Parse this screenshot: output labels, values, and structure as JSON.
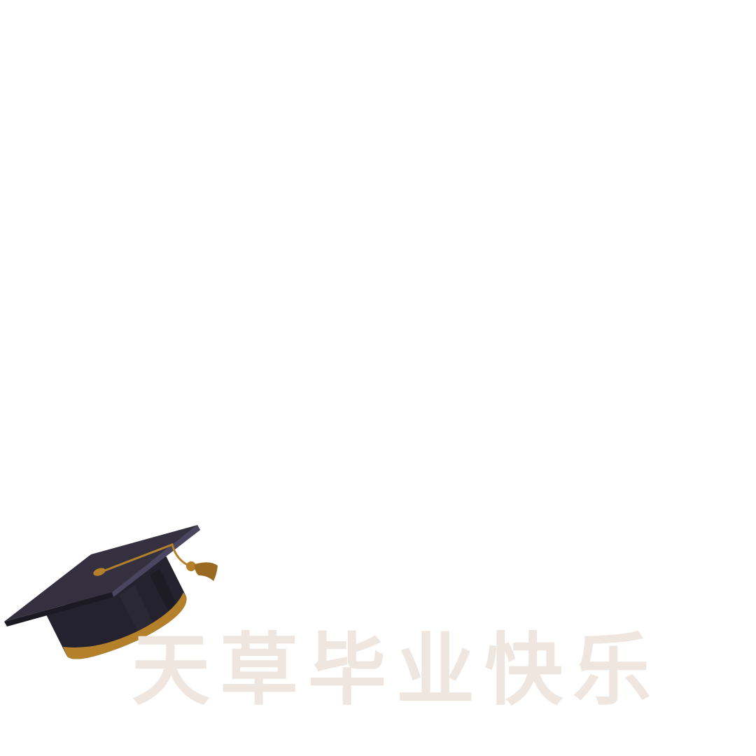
{
  "graphic": {
    "icon": "graduation-cap-icon",
    "colors": {
      "background": "#ffffff",
      "cap_top": "#34303f",
      "cap_edge": "#4a4660",
      "cap_body": "#24222e",
      "cap_shadow": "#1b1a22",
      "tassel": "#b4802a",
      "tassel_dark": "#9a6a22",
      "text": "#efe6df"
    }
  },
  "headline": {
    "text": "天草毕业快乐"
  }
}
